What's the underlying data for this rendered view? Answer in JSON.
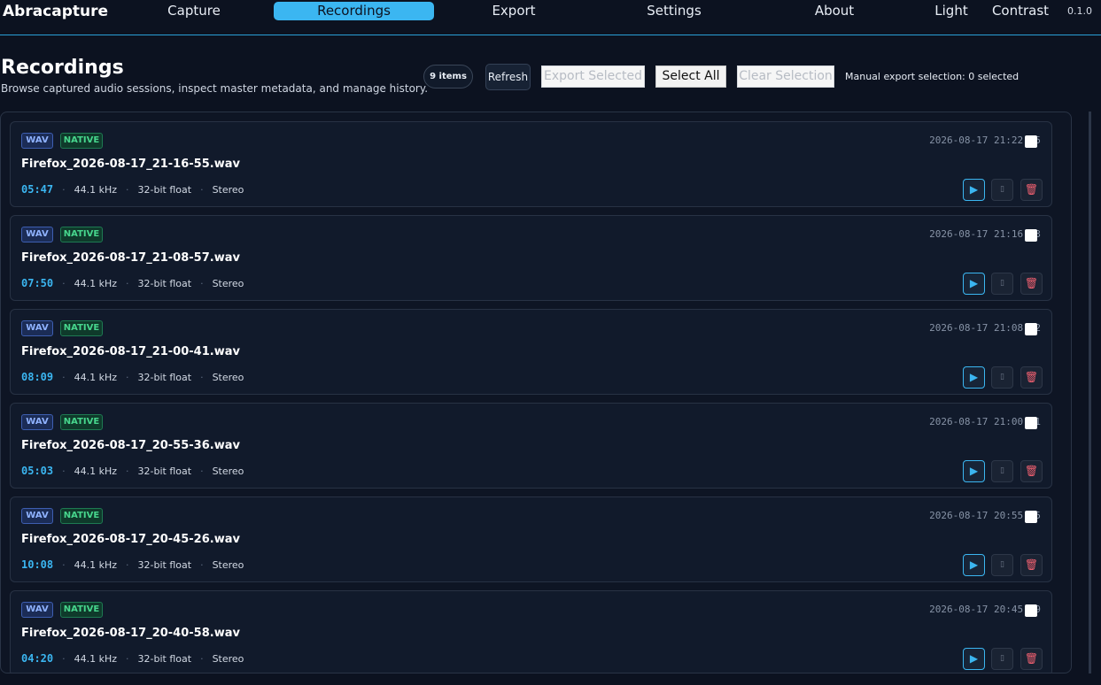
{
  "app": {
    "brand": "Abracapture",
    "version": "0.1.0",
    "nav": [
      {
        "label": "Capture",
        "active": false
      },
      {
        "label": "Recordings",
        "active": true
      },
      {
        "label": "Export",
        "active": false
      },
      {
        "label": "Settings",
        "active": false
      },
      {
        "label": "About",
        "active": false
      },
      {
        "label": "Light",
        "active": false
      },
      {
        "label": "Contrast",
        "active": false
      }
    ]
  },
  "header": {
    "title": "Recordings",
    "subtitle": "Browse captured audio sessions, inspect master metadata, and manage history.",
    "count": "9 items",
    "refresh": "Refresh",
    "export_selected": "Export Selected",
    "select_all": "Select All",
    "clear_selection": "Clear Selection",
    "manual_selection": "Manual export selection: 0 selected"
  },
  "accent_color": "#3bb6f1",
  "recordings": [
    {
      "format": "WAV",
      "source": "NATIVE",
      "file": "Firefox_2026-08-17_21-16-55.wav",
      "date": "2026-08-17 21:22:05",
      "duration": "05:47",
      "rate": "44.1 kHz",
      "depth": "32-bit float",
      "channels": "Stereo"
    },
    {
      "format": "WAV",
      "source": "NATIVE",
      "file": "Firefox_2026-08-17_21-08-57.wav",
      "date": "2026-08-17 21:16:53",
      "duration": "07:50",
      "rate": "44.1 kHz",
      "depth": "32-bit float",
      "channels": "Stereo"
    },
    {
      "format": "WAV",
      "source": "NATIVE",
      "file": "Firefox_2026-08-17_21-00-41.wav",
      "date": "2026-08-17 21:08:52",
      "duration": "08:09",
      "rate": "44.1 kHz",
      "depth": "32-bit float",
      "channels": "Stereo"
    },
    {
      "format": "WAV",
      "source": "NATIVE",
      "file": "Firefox_2026-08-17_20-55-36.wav",
      "date": "2026-08-17 21:00:41",
      "duration": "05:03",
      "rate": "44.1 kHz",
      "depth": "32-bit float",
      "channels": "Stereo"
    },
    {
      "format": "WAV",
      "source": "NATIVE",
      "file": "Firefox_2026-08-17_20-45-26.wav",
      "date": "2026-08-17 20:55:35",
      "duration": "10:08",
      "rate": "44.1 kHz",
      "depth": "32-bit float",
      "channels": "Stereo"
    },
    {
      "format": "WAV",
      "source": "NATIVE",
      "file": "Firefox_2026-08-17_20-40-58.wav",
      "date": "2026-08-17 20:45:19",
      "duration": "04:20",
      "rate": "44.1 kHz",
      "depth": "32-bit float",
      "channels": "Stereo"
    }
  ],
  "icons": {
    "play": "play-icon",
    "middle": "select-icon",
    "delete": "trash-icon"
  }
}
